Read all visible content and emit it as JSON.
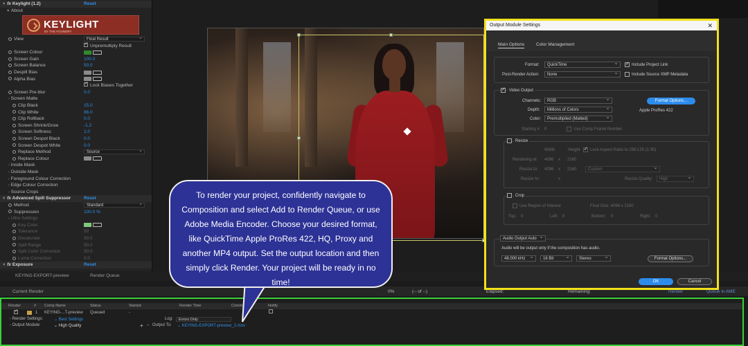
{
  "effect_controls": {
    "keylight_header": "Keylight (1.2)",
    "reset": "Reset",
    "about": "About",
    "logo_text": "KEYLIGHT",
    "logo_sub": "BY THE FOUNDRY",
    "rows": [
      {
        "label": "View",
        "value": "Final Result",
        "kind": "select"
      },
      {
        "label": "",
        "value": "Unpremultiply Result",
        "kind": "check"
      },
      {
        "label": "Screen Colour",
        "kind": "swatch",
        "color": "#2f8a2f"
      },
      {
        "label": "Screen Gain",
        "value": "100.0",
        "kind": "num"
      },
      {
        "label": "Screen Balance",
        "value": "50.0",
        "kind": "num"
      },
      {
        "label": "Despill Bias",
        "kind": "swatch",
        "color": "#8a8a8a"
      },
      {
        "label": "Alpha Bias",
        "kind": "swatch",
        "color": "#8a8a8a"
      },
      {
        "label": "",
        "value": "Lock Biases Together",
        "kind": "check"
      },
      {
        "label": "Screen Pre-blur",
        "value": "0.0",
        "kind": "num"
      },
      {
        "label": "Screen Matte",
        "kind": "group"
      },
      {
        "label": "Clip Black",
        "value": "15.0",
        "kind": "num",
        "indent": 1
      },
      {
        "label": "Clip White",
        "value": "86.0",
        "kind": "num",
        "indent": 1
      },
      {
        "label": "Clip Rollback",
        "value": "0.0",
        "kind": "num",
        "indent": 1
      },
      {
        "label": "Screen Shrink/Grow",
        "value": "-1.2",
        "kind": "num",
        "indent": 1
      },
      {
        "label": "Screen Softness",
        "value": "1.0",
        "kind": "num",
        "indent": 1
      },
      {
        "label": "Screen Despot Black",
        "value": "0.0",
        "kind": "num",
        "indent": 1
      },
      {
        "label": "Screen Despot White",
        "value": "0.0",
        "kind": "num",
        "indent": 1
      },
      {
        "label": "Replace Method",
        "value": "Source",
        "kind": "select",
        "indent": 1
      },
      {
        "label": "Replace Colour",
        "kind": "swatch",
        "color": "#8a8a8a",
        "indent": 1
      },
      {
        "label": "Inside Mask",
        "kind": "group"
      },
      {
        "label": "Outside Mask",
        "kind": "group"
      },
      {
        "label": "Foreground Colour Correction",
        "kind": "group"
      },
      {
        "label": "Edge Colour Correction",
        "kind": "group"
      },
      {
        "label": "Source Crops",
        "kind": "group"
      }
    ],
    "spill_header": "Advanced Spill Suppressor",
    "spill_rows": [
      {
        "label": "Method",
        "value": "Standard",
        "kind": "select"
      },
      {
        "label": "Suppression",
        "value": "100.0 %",
        "kind": "num"
      },
      {
        "label": "Ultra Settings",
        "kind": "group",
        "dim": true
      },
      {
        "label": "Key Color",
        "kind": "swatch",
        "color": "#7ec87e",
        "dim": true,
        "indent": 1
      },
      {
        "label": "Tolerance",
        "value": "50",
        "kind": "num",
        "dim": true,
        "indent": 1
      },
      {
        "label": "Desaturate",
        "value": "50.0",
        "kind": "num",
        "dim": true,
        "indent": 1
      },
      {
        "label": "Spill Range",
        "value": "50.0",
        "kind": "num",
        "dim": true,
        "indent": 1
      },
      {
        "label": "Spill Color Correction",
        "value": "50.0",
        "kind": "num",
        "dim": true,
        "indent": 1
      },
      {
        "label": "Luma Correction",
        "value": "0.0",
        "kind": "num",
        "dim": true,
        "indent": 1
      }
    ],
    "exposure_header": "Exposure"
  },
  "bottom_tabs": {
    "comp_tab": "KEYING-EXPORT-preview",
    "queue_tab": "Render Queue",
    "current_render": "Current Render",
    "percent": "0%",
    "of": "(-- of --)",
    "elapsed": "Elapsed:",
    "remaining": "Remaining:",
    "render_btn": "Render",
    "queue_btn": "Queue in AME"
  },
  "render_queue": {
    "columns": [
      "Render",
      "#",
      "Comp Name",
      "Status",
      "Started",
      "Render Time",
      "Comment",
      "Notify"
    ],
    "item": {
      "number": "1",
      "comp": "KEYING-...T-preview",
      "status": "Queued",
      "started": "-"
    },
    "render_settings_label": "Render Settings:",
    "render_settings_value": "Best Settings",
    "output_module_label": "Output Module:",
    "output_module_value": "High Quality",
    "log_label": "Log:",
    "log_value": "Errors Only",
    "output_to_label": "Output To:",
    "output_to_value": "KEYING-EXPORT-preview_2.mov"
  },
  "output_module": {
    "title": "Output Module Settings",
    "tabs": [
      "Main Options",
      "Color Management"
    ],
    "format_label": "Format:",
    "format_value": "QuickTime",
    "post_render_label": "Post-Render Action:",
    "post_render_value": "None",
    "include_project_link": "Include Project Link",
    "include_xmp": "Include Source XMP Metadata",
    "video_output": "Video Output",
    "channels_label": "Channels:",
    "channels_value": "RGB",
    "depth_label": "Depth:",
    "depth_value": "Millions of Colors",
    "color_label": "Color:",
    "color_value": "Premultiplied (Matted)",
    "starting_label": "Starting #:",
    "starting_value": "0",
    "use_comp_frame": "Use Comp Frame Number",
    "format_options_btn": "Format Options...",
    "codec": "Apple ProRes 422",
    "resize": "Resize",
    "width_label": "Width",
    "height_label": "Height",
    "lock_aspect": "Lock Aspect Ratio to 256:135 (1.90)",
    "rendering_at_label": "Rendering at:",
    "rendering_w": "4096",
    "rendering_h": "2160",
    "resize_to_label": "Resize to:",
    "resize_to_w": "4096",
    "resize_to_h": "2160",
    "resize_to_preset": "Custom",
    "resize_pct_label": "Resize %:",
    "resize_quality_label": "Resize Quality:",
    "resize_quality_value": "High",
    "crop": "Crop",
    "use_roi": "Use Region of Interest",
    "final_size": "Final Size: 4096 x 2160",
    "top_label": "Top:",
    "top_value": "0",
    "left_label": "Left:",
    "left_value": "0",
    "bottom_label": "Bottom:",
    "bottom_value": "0",
    "right_label": "Right:",
    "right_value": "0",
    "audio_output": "Audio Output Auto",
    "audio_note": "Audio will be output only if the composition has audio.",
    "sample_rate": "48.000 kHz",
    "bit_depth": "16 Bit",
    "channels_audio": "Stereo",
    "audio_format_options": "Format Options...",
    "ok": "OK",
    "cancel": "Cancel"
  },
  "bubble": {
    "text": "To render your project, confidently navigate to Composition and select Add to Render Queue, or use Adobe Media Encoder. Choose your desired format, like QuickTime Apple ProRes 422, HQ, Proxy and another MP4 output. Set the output location and then simply click Render. Your project will be ready in no time!"
  },
  "colors": {
    "dialog_highlight": "#f2e11a",
    "queue_highlight": "#38d238",
    "bubble_fill": "#2d3296",
    "link_blue": "#2f8fe8",
    "primary_button": "#2d8ceb"
  }
}
